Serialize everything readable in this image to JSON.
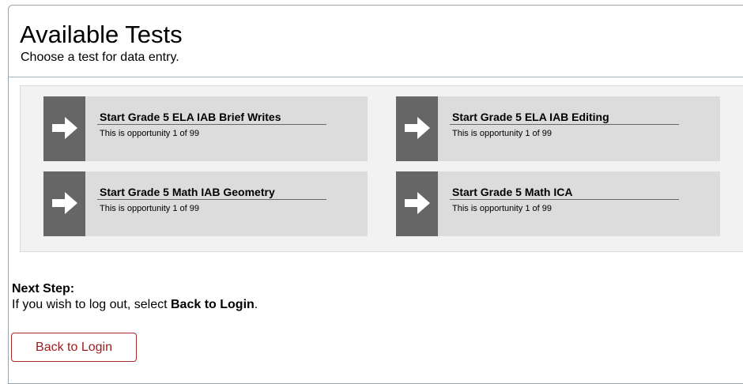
{
  "header": {
    "title": "Available Tests",
    "subtitle": "Choose a test for data entry."
  },
  "tests": [
    {
      "label": "Start Grade 5 ELA IAB Brief Writes",
      "opportunity": "This is opportunity 1 of 99",
      "icon": "arrow-right-icon"
    },
    {
      "label": "Start Grade 5 ELA IAB Editing",
      "opportunity": "This is opportunity 1 of 99",
      "icon": "arrow-right-icon"
    },
    {
      "label": "Start Grade 5 Math IAB Geometry",
      "opportunity": "This is opportunity 1 of 99",
      "icon": "arrow-right-icon"
    },
    {
      "label": "Start Grade 5 Math ICA",
      "opportunity": "This is opportunity 1 of 99",
      "icon": "arrow-right-icon"
    }
  ],
  "next_step": {
    "heading": "Next Step:",
    "instruction_prefix": "If you wish to log out, select ",
    "instruction_bold": "Back to Login",
    "instruction_suffix": "."
  },
  "back_button": {
    "label": "Back to Login"
  },
  "colors": {
    "card_bg": "#dcdcdc",
    "arrow_bg": "#666666",
    "button_accent": "#9b1c1c"
  }
}
